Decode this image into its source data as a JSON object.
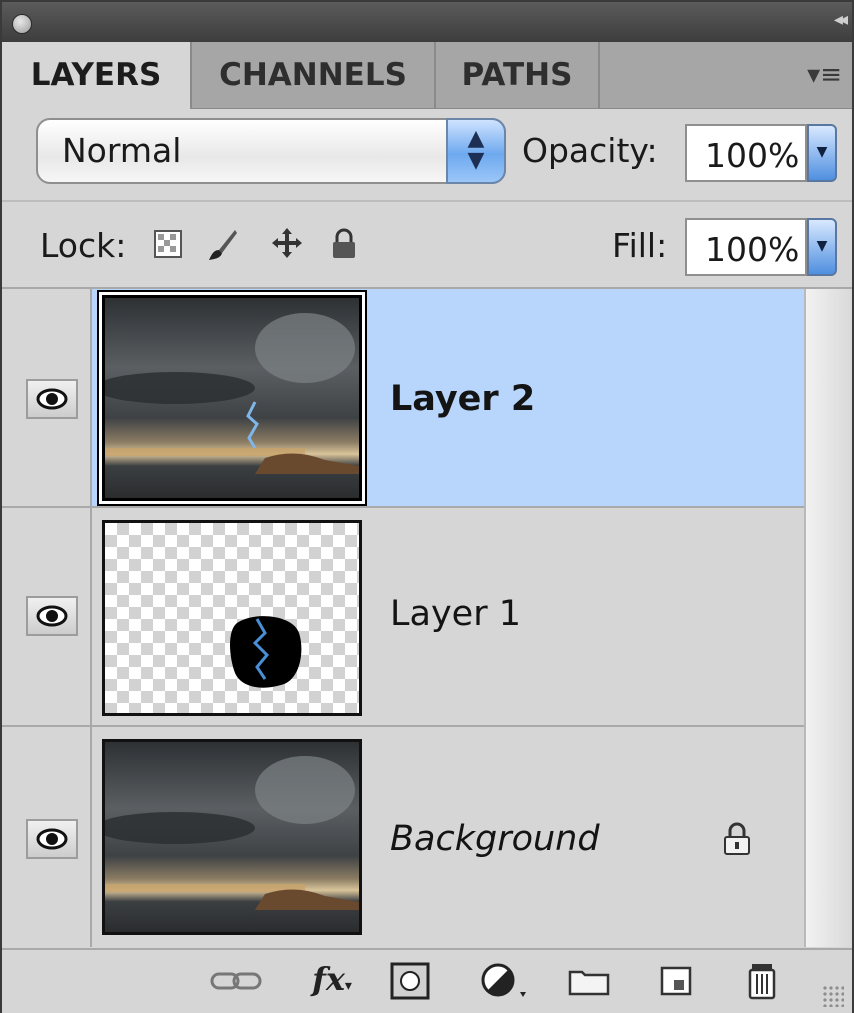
{
  "tabs": [
    {
      "label": "LAYERS"
    },
    {
      "label": "CHANNELS"
    },
    {
      "label": "PATHS"
    }
  ],
  "blend_mode": {
    "selected": "Normal"
  },
  "opacity": {
    "label": "Opacity:",
    "value": "100%"
  },
  "lock": {
    "label": "Lock:"
  },
  "fill": {
    "label": "Fill:",
    "value": "100%"
  },
  "layers": [
    {
      "name": "Layer 2",
      "selected": true,
      "visible": true
    },
    {
      "name": "Layer 1",
      "selected": false,
      "visible": true
    },
    {
      "name": "Background",
      "selected": false,
      "visible": true,
      "locked": true
    }
  ],
  "footer": {
    "fx_label": "fx",
    "icons": [
      "link-layers-icon",
      "layer-style-icon",
      "add-mask-icon",
      "adjustment-layer-icon",
      "new-group-icon",
      "new-layer-icon",
      "trash-icon"
    ]
  },
  "colors": {
    "selection": "#b8d5fb",
    "panel": "#d6d6d6",
    "accent_blue": "#4f8fe0"
  }
}
